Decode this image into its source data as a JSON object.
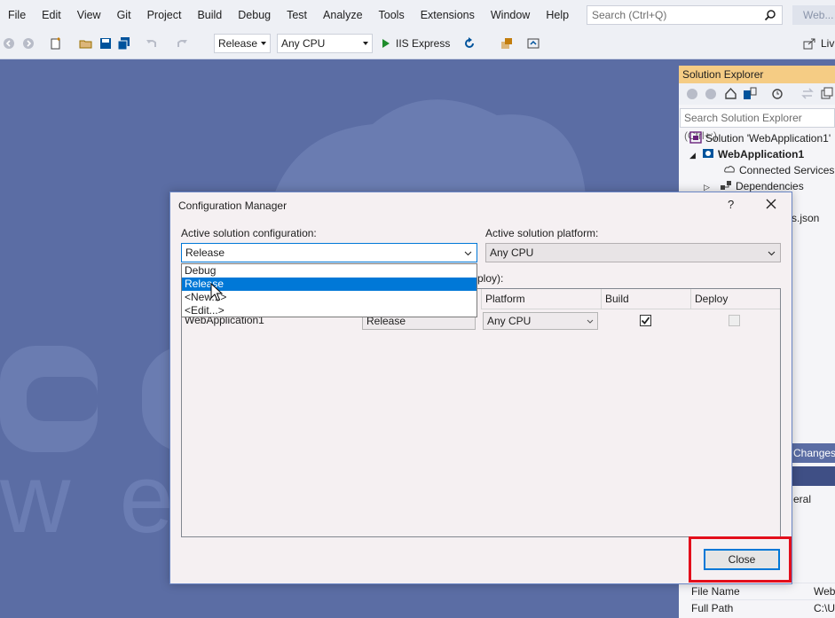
{
  "menu": [
    "File",
    "Edit",
    "View",
    "Git",
    "Project",
    "Build",
    "Debug",
    "Test",
    "Analyze",
    "Tools",
    "Extensions",
    "Window",
    "Help"
  ],
  "search": {
    "placeholder": "Search (Ctrl+Q)"
  },
  "app_title": "Web...",
  "toolbar": {
    "configuration": "Release",
    "platform": "Any CPU",
    "run_target": "IIS Express",
    "live_share": "Liv"
  },
  "watermark": {
    "text": "web hosting"
  },
  "solution_explorer": {
    "title": "Solution Explorer",
    "search_placeholder": "Search Solution Explorer (Ctrl+;)",
    "nodes": [
      "Solution 'WebApplication1'",
      "WebApplication1",
      "Connected Services",
      "Dependencies",
      "s.json"
    ],
    "strip_label": "Changes",
    "strip_label2": "eral",
    "properties": [
      {
        "name": "File Name",
        "value": "Web"
      },
      {
        "name": "Full Path",
        "value": "C:\\U"
      }
    ]
  },
  "dialog": {
    "title": "Configuration Manager",
    "help_label": "?",
    "active_config_label": "Active solution configuration:",
    "active_config_value": "Release",
    "active_platform_label": "Active solution platform:",
    "active_platform_value": "Any CPU",
    "dropdown_options": [
      "Debug",
      "Release",
      "<New...>",
      "<Edit...>"
    ],
    "dropdown_selected_index": 1,
    "contexts_label_fragment": "ploy):",
    "columns": [
      "Platform",
      "Build",
      "Deploy"
    ],
    "rows": [
      {
        "project": "WebApplication1",
        "configuration": "Release",
        "platform": "Any CPU",
        "build": true,
        "deploy": false
      }
    ],
    "close_label": "Close"
  },
  "colors": {
    "background": "#5b6da4",
    "selection": "#0078d7",
    "highlight": "#e30e1b",
    "explorer_title": "#f5cc84"
  }
}
